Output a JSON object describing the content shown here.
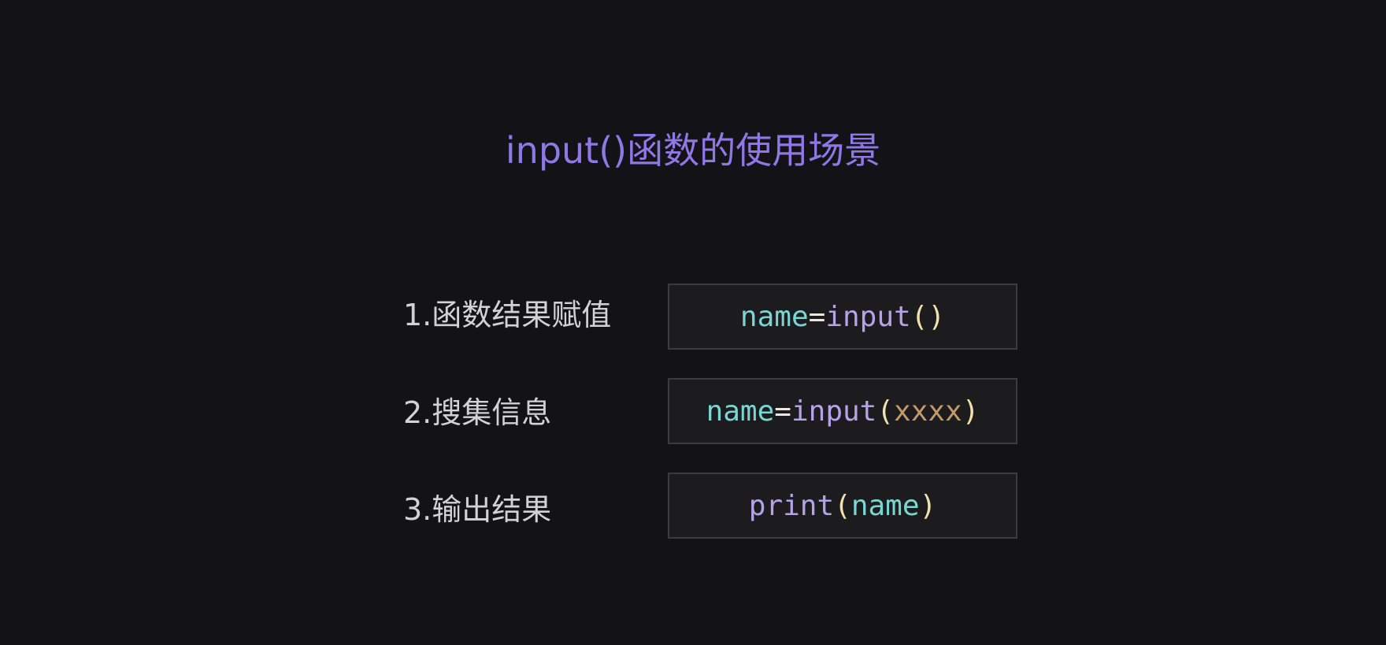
{
  "colors": {
    "background": "#121217",
    "title": "#8d79e6",
    "label": "#d2d2d6",
    "code_box_bg": "#1c1c1e",
    "code_box_border": "#3c3c40",
    "code_variable": "#79d6d3",
    "code_operator": "#e9e7de",
    "code_function": "#b5a3e9",
    "code_paren": "#f2e1ac",
    "code_argument": "#c49a6c"
  },
  "title": "input()函数的使用场景",
  "rows": [
    {
      "label": "1.函数结果赋值",
      "code": {
        "var": "name",
        "op": "=",
        "fn": "input",
        "open": "(",
        "arg": "",
        "close": ")"
      }
    },
    {
      "label": "2.搜集信息",
      "code": {
        "var": "name",
        "op": "=",
        "fn": "input",
        "open": "(",
        "arg": "xxxx",
        "close": ")"
      }
    },
    {
      "label": "3.输出结果",
      "code": {
        "fn": "print",
        "open": "(",
        "var": "name",
        "close": ")"
      }
    }
  ]
}
